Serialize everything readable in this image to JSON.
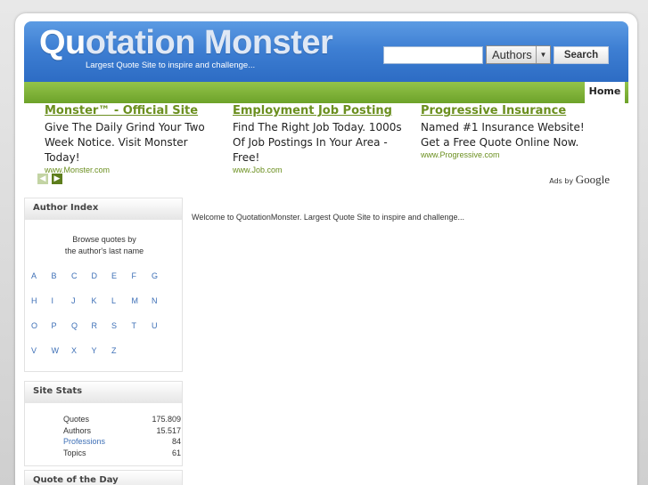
{
  "header": {
    "logo_part1": "Qu",
    "logo_part2": "otation Monster",
    "tagline": "Largest Quote Site to inspire and challenge...",
    "search_value": "",
    "search_select": "Authors",
    "search_button": "Search"
  },
  "nav": {
    "home": "Home"
  },
  "ads": [
    {
      "title": "Monster™ - Official Site",
      "text": "Give The Daily Grind Your Two Week Notice. Visit Monster Today!",
      "url": "www.Monster.com"
    },
    {
      "title": "Employment Job Posting",
      "text": "Find The Right Job Today. 1000s Of Job Postings In Your Area -Free!",
      "url": "www.Job.com"
    },
    {
      "title": "Progressive Insurance",
      "text": "Named #1 Insurance Website! Get a Free Quote Online Now.",
      "url": "www.Progressive.com"
    }
  ],
  "ads_by": {
    "prefix": "Ads by",
    "brand": "Google"
  },
  "author_index": {
    "title": "Author Index",
    "browse_line1": "Browse quotes by",
    "browse_line2": "the author's last name",
    "letters": [
      "A",
      "B",
      "C",
      "D",
      "E",
      "F",
      "G",
      "H",
      "I",
      "J",
      "K",
      "L",
      "M",
      "N",
      "O",
      "P",
      "Q",
      "R",
      "S",
      "T",
      "U",
      "V",
      "W",
      "X",
      "Y",
      "Z"
    ]
  },
  "site_stats": {
    "title": "Site Stats",
    "rows": [
      {
        "label": "Quotes",
        "value": "175.809"
      },
      {
        "label": "Authors",
        "value": "15.517"
      },
      {
        "label": "Professions",
        "value": "84"
      },
      {
        "label": "Topics",
        "value": "61"
      }
    ]
  },
  "quote_of_day": {
    "title": "Quote of the Day"
  },
  "main": {
    "welcome": "Welcome to QuotationMonster. Largest Quote Site to inspire and challenge..."
  },
  "colors": {
    "header_blue": "#3e7fd3",
    "nav_green": "#7bb030",
    "ad_green": "#6b8f1f",
    "link_blue": "#3d6fb6"
  }
}
